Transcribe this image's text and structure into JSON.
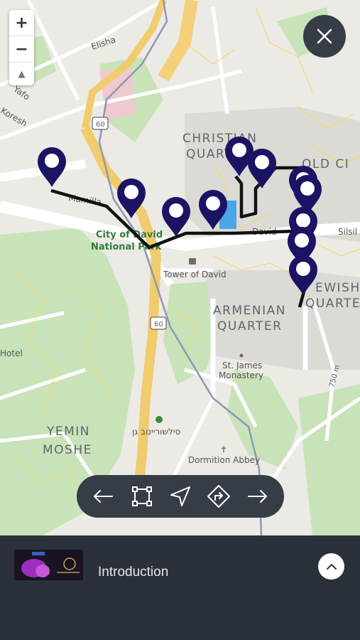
{
  "map": {
    "zoom_in": "+",
    "zoom_out": "−",
    "compass": "▲",
    "labels": {
      "elisha": "Elisha",
      "yafo": "Yafo",
      "koresh": "Koresh",
      "route60_top": "60",
      "route60_mid": "60",
      "christian_1": "CHRISTIAN",
      "christian_2": "QUARTER",
      "old_city": "OLD CI",
      "mamilla": "Mamilla",
      "silsila": "Silsil",
      "david": "David",
      "city_of_david_1": "City of David",
      "city_of_david_2": "National Park",
      "tower_of_david": "Tower of David",
      "armenian_1": "ARMENIAN",
      "armenian_2": "QUARTER",
      "jewish_1": "EWISH",
      "jewish_2": "QUARTER",
      "st_james_1": "St. James",
      "st_james_2": "Monastery",
      "hotel": "Hotel",
      "yemin_1": "YEMIN",
      "yemin_2": "MOSHE",
      "hebrew_park": "סילשוריינוב גן",
      "dormition": "Dormition Abbey",
      "distance": "750 m"
    }
  },
  "controls": {
    "close_icon": "close-icon",
    "toolbar": [
      "arrow-left-icon",
      "fit-bounds-icon",
      "navigate-icon",
      "directions-icon",
      "arrow-right-icon"
    ]
  },
  "bottom_sheet": {
    "title": "Introduction",
    "expand_icon": "chevron-up-icon"
  },
  "colors": {
    "marker": "#1b1464",
    "route": "#111111",
    "panel": "#2b3138",
    "button": "#363d46"
  }
}
